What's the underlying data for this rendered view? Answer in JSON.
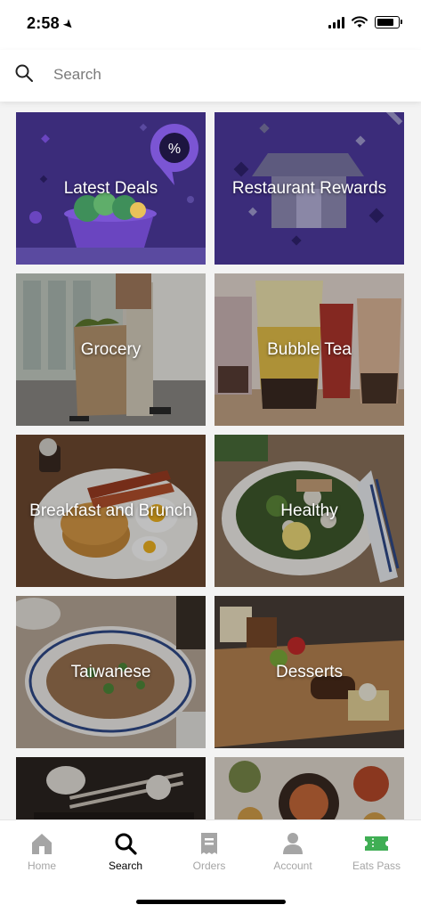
{
  "status": {
    "time": "2:58"
  },
  "search": {
    "placeholder": "Search"
  },
  "tiles": [
    {
      "label": "Latest Deals"
    },
    {
      "label": "Restaurant Rewards"
    },
    {
      "label": "Grocery"
    },
    {
      "label": "Bubble Tea"
    },
    {
      "label": "Breakfast and Brunch"
    },
    {
      "label": "Healthy"
    },
    {
      "label": "Taiwanese"
    },
    {
      "label": "Desserts"
    },
    {
      "label": ""
    },
    {
      "label": ""
    }
  ],
  "nav": [
    {
      "label": "Home",
      "icon": "home-icon"
    },
    {
      "label": "Search",
      "icon": "search-icon",
      "active": true
    },
    {
      "label": "Orders",
      "icon": "receipt-icon"
    },
    {
      "label": "Account",
      "icon": "person-icon"
    },
    {
      "label": "Eats Pass",
      "icon": "ticket-icon"
    }
  ],
  "colors": {
    "deals_purple": "#3b2c7a",
    "eats_pass_green": "#3fae54",
    "nav_inactive": "#a5a5a5"
  }
}
